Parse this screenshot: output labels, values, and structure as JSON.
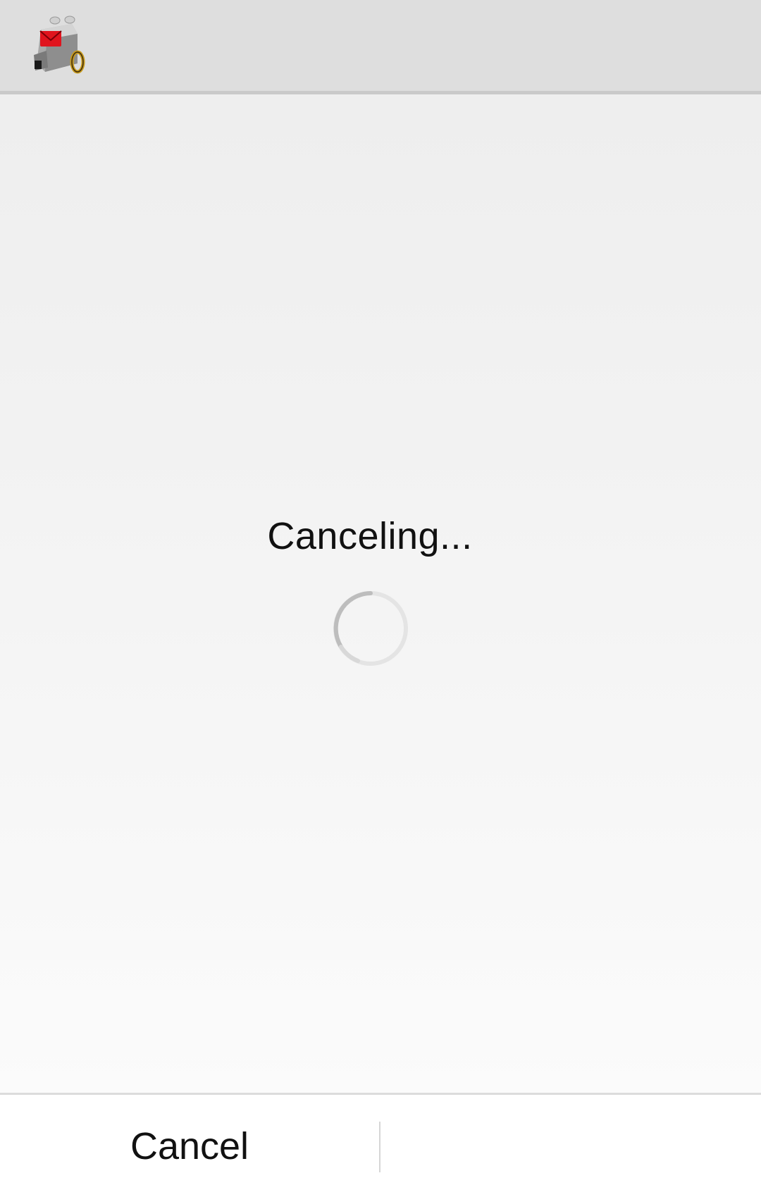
{
  "header": {
    "logo_icon": "robot-mail-app-icon",
    "accent_color": "#e0141e"
  },
  "main": {
    "status_text": "Canceling...",
    "spinner_icon": "loading-spinner"
  },
  "footer": {
    "cancel_label": "Cancel"
  }
}
